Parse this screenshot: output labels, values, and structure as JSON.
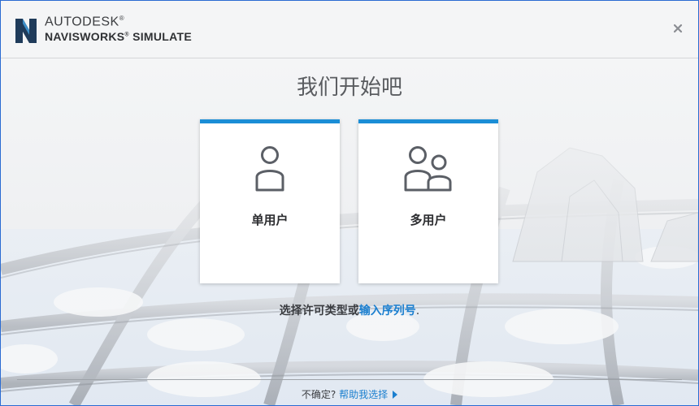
{
  "header": {
    "brand_company": "AUTODESK",
    "brand_product": "NAVISWORKS",
    "brand_edition": "SIMULATE",
    "registered_mark": "®",
    "logo_icon": "autodesk-n-logo",
    "close_icon": "close-x"
  },
  "main": {
    "title": "我们开始吧",
    "cards": [
      {
        "label": "单用户",
        "icon": "single-user-icon"
      },
      {
        "label": "多用户",
        "icon": "multi-user-icon"
      }
    ],
    "prompt_text": "选择许可类型或",
    "prompt_link": "输入序列号",
    "prompt_end": "."
  },
  "footer": {
    "question": "不确定?",
    "help_link": "帮助我选择"
  },
  "colors": {
    "accent": "#1b8ed6",
    "link": "#1b7fcf",
    "window_border": "#2a6bd2",
    "text": "#3a3c40"
  }
}
